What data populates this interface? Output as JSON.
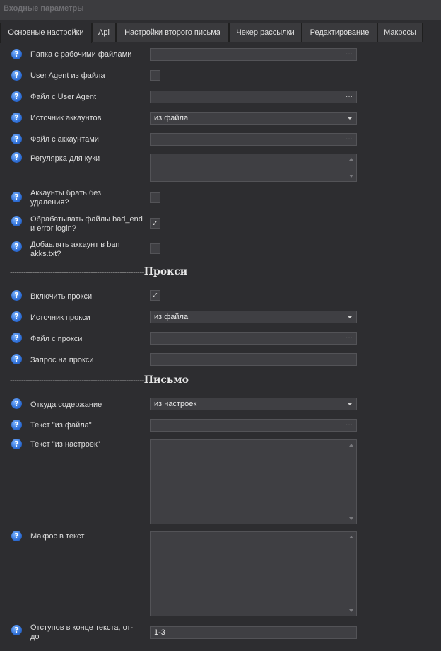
{
  "window": {
    "title": "Входные параметры"
  },
  "tabs": [
    {
      "label": "Основные настройки",
      "active": true
    },
    {
      "label": "Api"
    },
    {
      "label": "Настройки второго письма"
    },
    {
      "label": "Чекер рассылки"
    },
    {
      "label": "Редактирование"
    },
    {
      "label": "Макросы"
    }
  ],
  "fields": {
    "work_folder": {
      "label": "Папка с рабочими файлами",
      "value": "",
      "button": "···"
    },
    "ua_from_file": {
      "label": "User Agent из файла",
      "checked": false
    },
    "ua_file": {
      "label": "Файл с User Agent",
      "value": "",
      "button": "···"
    },
    "accounts_source": {
      "label": "Источник аккаунтов",
      "value": "из файла"
    },
    "accounts_file": {
      "label": "Файл с аккаунтами",
      "value": "",
      "button": "···"
    },
    "cookie_regex": {
      "label": "Регулярка для куки",
      "value": ""
    },
    "accounts_no_delete": {
      "label": "Аккаунты брать без удаления?",
      "checked": false
    },
    "process_bad_files": {
      "label": "Обрабатывать файлы bad_end и error login?",
      "checked": true,
      "mark": "✓"
    },
    "add_to_ban": {
      "label": "Добавлять аккаунт в ban akks.txt?",
      "checked": false
    }
  },
  "proxy_section": {
    "dashes": "------------------------------------------------------------",
    "title": "Прокси",
    "enable_proxy": {
      "label": "Включить прокси",
      "checked": true,
      "mark": "✓"
    },
    "proxy_source": {
      "label": "Источник прокси",
      "value": "из файла"
    },
    "proxy_file": {
      "label": "Файл с прокси",
      "value": "",
      "button": "···"
    },
    "proxy_request": {
      "label": "Запрос на прокси",
      "value": ""
    }
  },
  "letter_section": {
    "dashes": "------------------------------------------------------------",
    "title": "Письмо",
    "content_source": {
      "label": "Откуда содержание",
      "value": "из настроек"
    },
    "text_from_file": {
      "label": "Текст \"из файла\"",
      "value": "",
      "button": "···"
    },
    "text_from_settings": {
      "label": "Текст \"из настроек\"",
      "value": ""
    },
    "macro_in_text": {
      "label": "Макрос в текст",
      "value": ""
    },
    "end_indents": {
      "label": "Отступов в конце текста, от-до",
      "value": "1-3"
    }
  },
  "help_icon_glyph": "?"
}
